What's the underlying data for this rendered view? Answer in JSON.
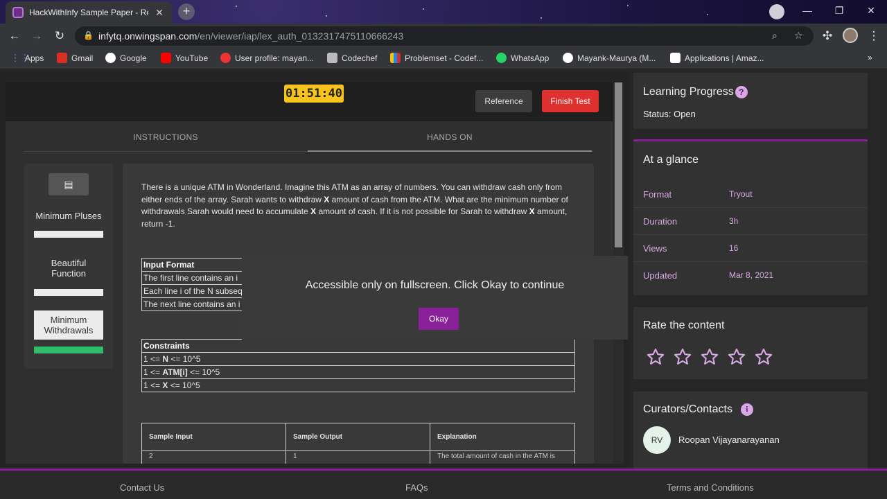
{
  "browser": {
    "tab_title": "HackWithInfy Sample Paper - Ro",
    "tab_close": "✕",
    "new_tab": "+",
    "url_host": "infytq.onwingspan.com",
    "url_path": "/en/viewer/iap/lex_auth_0132317475110666243",
    "window": {
      "minimize": "—",
      "restore": "❐",
      "close": "✕"
    }
  },
  "bookmarks": [
    {
      "label": "Apps",
      "color": "#4285f4"
    },
    {
      "label": "Gmail",
      "color": "#d93025"
    },
    {
      "label": "Google",
      "color": "#ffffff"
    },
    {
      "label": "YouTube",
      "color": "#ff0000"
    },
    {
      "label": "User profile: mayan...",
      "color": "#e33"
    },
    {
      "label": "Codechef",
      "color": "#bbbbbb"
    },
    {
      "label": "Problemset - Codef...",
      "color": "#1e88e5"
    },
    {
      "label": "WhatsApp",
      "color": "#25d366"
    },
    {
      "label": "Mayank-Maurya (M...",
      "color": "#ffffff"
    },
    {
      "label": "Applications | Amaz...",
      "color": "#ffffff"
    }
  ],
  "bookmarks_more": "»",
  "test": {
    "timer": "01:51:40",
    "reference_label": "Reference",
    "finish_label": "Finish Test",
    "tabs": [
      "INSTRUCTIONS",
      "HANDS ON"
    ]
  },
  "questions": [
    {
      "label": "Minimum Pluses",
      "state": "normal"
    },
    {
      "label": "Beautiful Function",
      "state": "normal"
    },
    {
      "label": "Minimum Withdrawals",
      "state": "selected"
    }
  ],
  "problem": {
    "p1": "There is a unique ATM in Wonderland. Imagine this ATM as an array of numbers. You can withdraw cash only from either ends of the array. Sarah wants to withdraw ",
    "x1": "X",
    "p2": " amount of cash from the ATM. What are the minimum number of withdrawals Sarah would need to accumulate ",
    "x2": "X",
    "p3": " amount of cash. If it is not possible for Sarah to withdraw ",
    "x3": "X",
    "p4": " amount, return -1.",
    "input_format": {
      "header": "Input Format",
      "rows": [
        "The first line contains an i",
        "Each line i of the N subseq",
        "The next line contains an i"
      ]
    },
    "constraints": {
      "header": "Constraints",
      "rows": [
        {
          "a": "1 <= ",
          "b": "N",
          "c": " <= 10^5"
        },
        {
          "a": "1 <= ",
          "b": "ATM[i]",
          "c": " <= 10^5"
        },
        {
          "a": "1 <= ",
          "b": "X",
          "c": " <= 10^5"
        }
      ]
    },
    "samples": {
      "headers": [
        "Sample Input",
        "Sample Output",
        "Explanation"
      ],
      "row": [
        "2",
        "1",
        "The total amount of cash in the ATM is"
      ]
    }
  },
  "modal": {
    "message": "Accessible only on fullscreen. Click Okay to continue",
    "ok_label": "Okay"
  },
  "sidebar": {
    "progress_title": "Learning Progress",
    "status": "Status: Open",
    "glance_title": "At a glance",
    "glance": [
      {
        "key": "Format",
        "value": "Tryout"
      },
      {
        "key": "Duration",
        "value": "3h"
      },
      {
        "key": "Views",
        "value": "16"
      },
      {
        "key": "Updated",
        "value": "Mar 8, 2021"
      }
    ],
    "rate_title": "Rate the content",
    "rating": 0,
    "rating_max": 5,
    "curators_title": "Curators/Contacts",
    "curator_initials": "RV",
    "curator_name": "Roopan Vijayanarayanan"
  },
  "footer": [
    "Contact Us",
    "FAQs",
    "Terms and Conditions"
  ],
  "colors": {
    "accent": "#8a1f9a",
    "timer": "#f7c31c",
    "finish": "#e03131",
    "done": "#2fbd6b"
  }
}
